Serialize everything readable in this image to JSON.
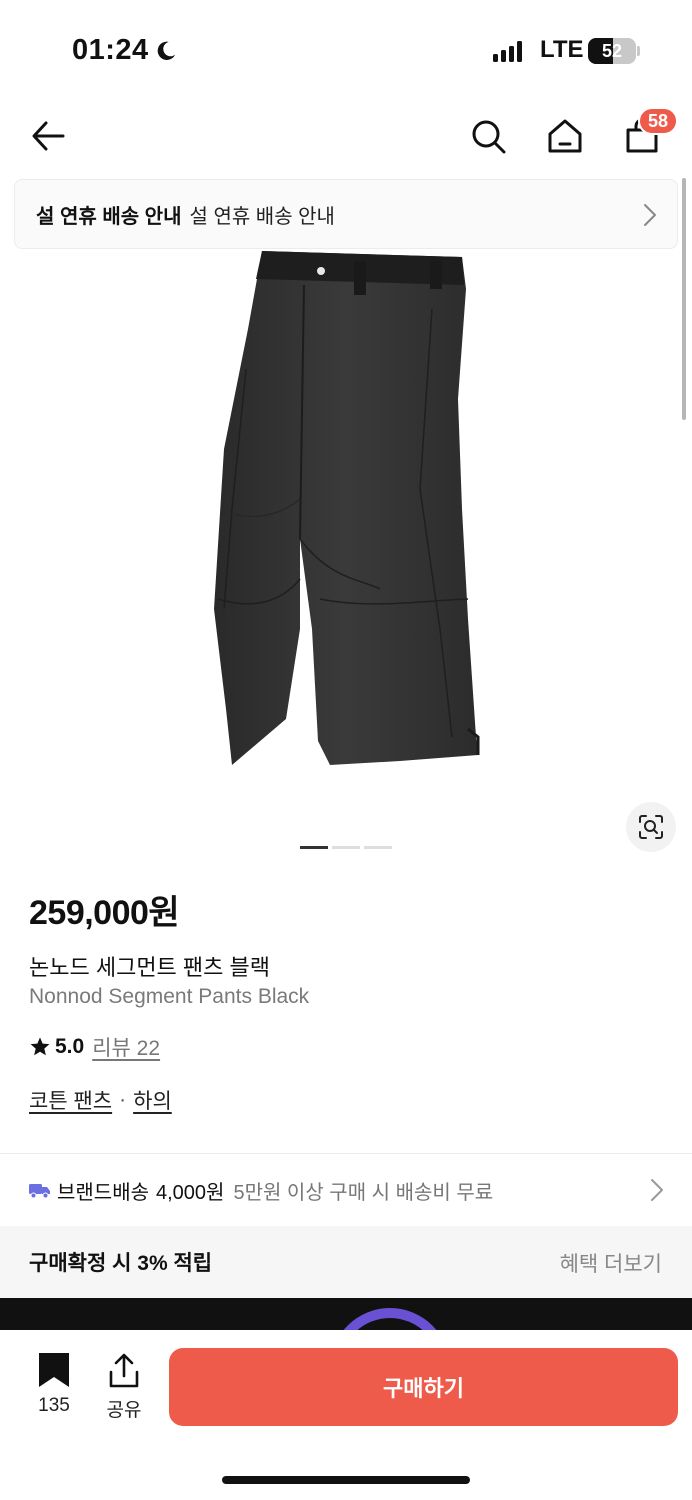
{
  "status_bar": {
    "time": "01:24",
    "network": "LTE",
    "battery": "52",
    "battery_level_percent": 52
  },
  "header": {
    "cart_count": "58",
    "icons": [
      "back-arrow-icon",
      "search-icon",
      "home-icon",
      "cart-icon"
    ]
  },
  "notice": {
    "title": "설 연휴 배송 안내",
    "text": "설 연휴 배송 안내"
  },
  "gallery": {
    "image_alt": "",
    "page_count": 3,
    "active_page": 1
  },
  "product": {
    "price": "259,000원",
    "name_kr": "논노드 세그먼트 팬츠 블랙",
    "name_en": "Nonnod Segment Pants Black",
    "rating": "5.0",
    "review_label": "리뷰 22",
    "category_1": "코튼 팬츠",
    "category_sep": "·",
    "category_2": "하의"
  },
  "delivery": {
    "label": "브랜드배송",
    "fee": "4,000원",
    "note": "5만원 이상 구매 시 배송비 무료"
  },
  "points": {
    "text": "구매확정 시 3% 적립",
    "more": "혜택 더보기"
  },
  "bottom_bar": {
    "bookmark_count": "135",
    "share_label": "공유",
    "buy_label": "구매하기"
  },
  "colors": {
    "accent": "#ef5b4b",
    "delivery_truck": "#6b6fe0"
  }
}
